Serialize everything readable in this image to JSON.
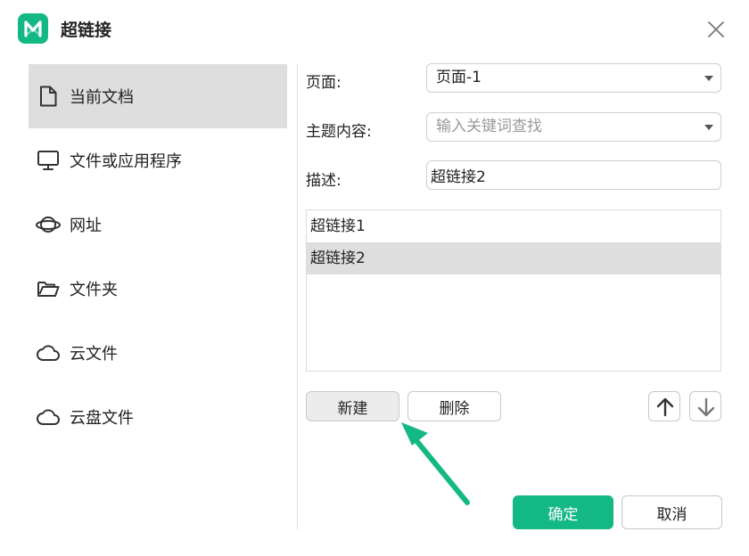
{
  "dialog": {
    "title": "超链接"
  },
  "sidebar": {
    "items": [
      {
        "label": "当前文档",
        "icon": "document-icon",
        "active": true
      },
      {
        "label": "文件或应用程序",
        "icon": "monitor-icon",
        "active": false
      },
      {
        "label": "网址",
        "icon": "planet-icon",
        "active": false
      },
      {
        "label": "文件夹",
        "icon": "folder-icon",
        "active": false
      },
      {
        "label": "云文件",
        "icon": "cloud-icon",
        "active": false
      },
      {
        "label": "云盘文件",
        "icon": "cloud-drive-icon",
        "active": false
      }
    ]
  },
  "form": {
    "page_label": "页面:",
    "page_value": "页面-1",
    "topic_label": "主题内容:",
    "topic_placeholder": "输入关键词查找",
    "desc_label": "描述:",
    "desc_value": "超链接2"
  },
  "link_list": {
    "items": [
      "超链接1",
      "超链接2"
    ],
    "selected_index": 1
  },
  "buttons": {
    "new": "新建",
    "delete": "删除",
    "confirm": "确定",
    "cancel": "取消"
  },
  "colors": {
    "accent": "#14b884",
    "annotation": "#14b884",
    "selection": "#dedede"
  }
}
